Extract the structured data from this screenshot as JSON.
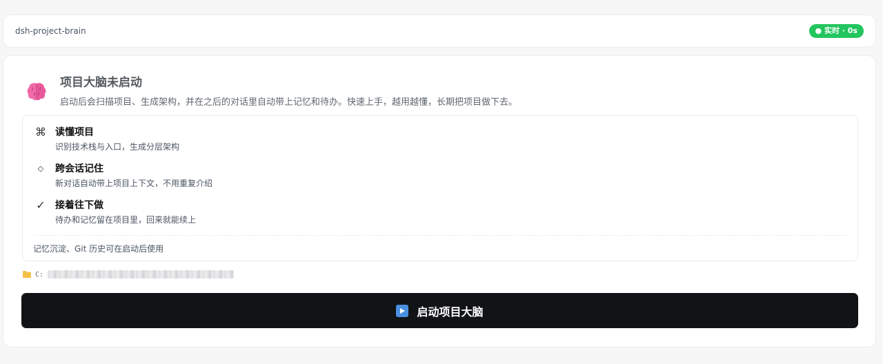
{
  "header": {
    "project_name": "dsh-project-brain",
    "status_badge": "● 实时 · 0s"
  },
  "hero": {
    "icon": "brain-icon",
    "title": "项目大脑未启动",
    "description": "启动后会扫描项目、生成架构，并在之后的对话里自动带上记忆和待办。快速上手，越用越懂，长期把项目做下去。"
  },
  "features": {
    "items": [
      {
        "icon": "⌘",
        "icon_name": "command-icon",
        "title": "读懂项目",
        "desc": "识别技术栈与入口，生成分层架构"
      },
      {
        "icon": "◇",
        "icon_name": "diamond-icon",
        "title": "跨会话记住",
        "desc": "新对话自动带上项目上下文，不用重复介绍"
      },
      {
        "icon": "✓",
        "icon_name": "check-icon",
        "title": "接着往下做",
        "desc": "待办和记忆留在项目里，回来就能续上"
      }
    ],
    "footer": "记忆沉淀、Git 历史可在启动后使用"
  },
  "path": {
    "icon": "folder-icon",
    "prefix": "C:"
  },
  "launch": {
    "icon": "play-icon",
    "label": "启动项目大脑"
  },
  "colors": {
    "badge_green": "#22c55e",
    "button_dark": "#121316",
    "play_blue": "#4a90e2",
    "folder_yellow": "#f5c04a"
  }
}
